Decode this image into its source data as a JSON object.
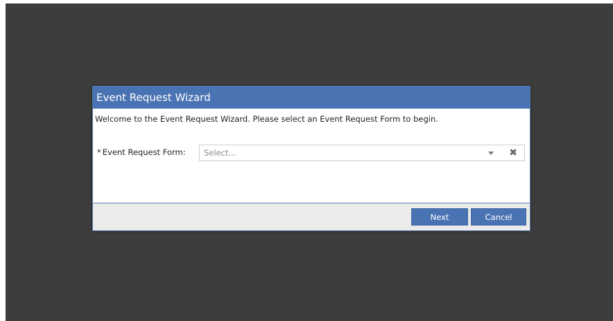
{
  "dialog": {
    "title": "Event Request Wizard",
    "welcome_text": "Welcome to the Event Request Wizard. Please select an Event Request Form to begin.",
    "field": {
      "required_mark": "*",
      "label": "Event Request Form:",
      "placeholder": "Select...",
      "clear_glyph": "✖"
    },
    "buttons": {
      "next_label": "Next",
      "cancel_label": "Cancel"
    }
  },
  "colors": {
    "header_bg": "#4a73b3",
    "overlay_bg": "#3d3d3d",
    "footer_bg": "#ebebeb"
  },
  "icons": {
    "dropdown": "chevron-down-icon",
    "clear": "close-icon"
  }
}
